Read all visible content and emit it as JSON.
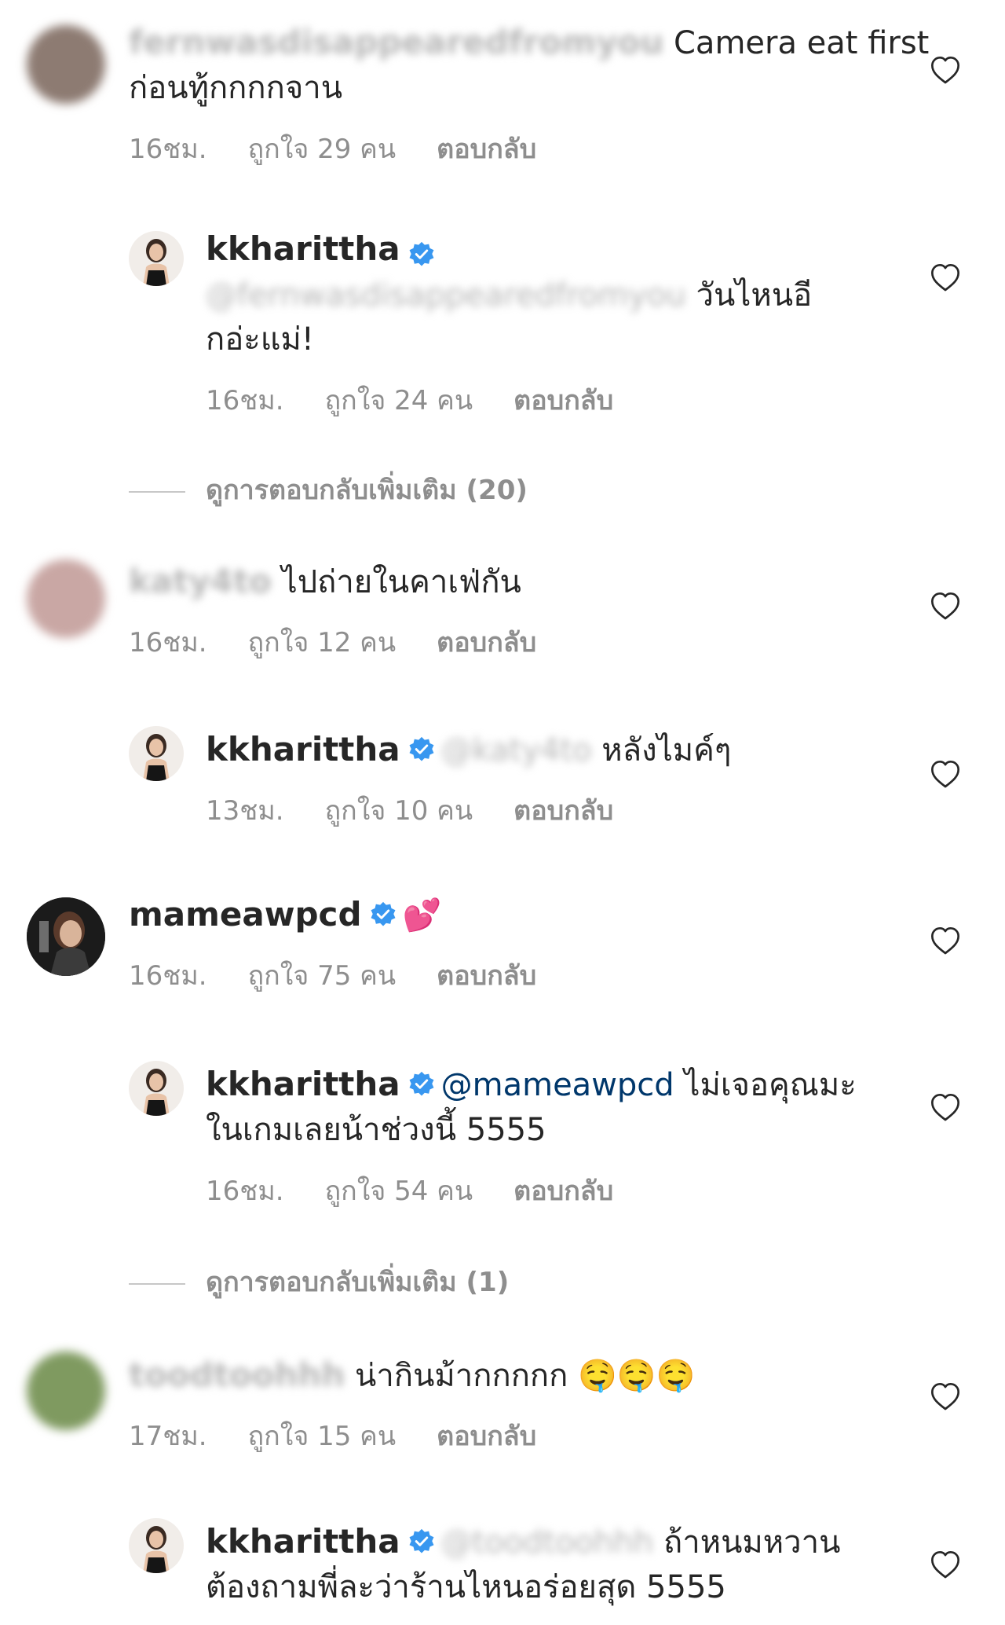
{
  "comments": [
    {
      "user": "fernwasdisappearedfromyou",
      "text1": " Camera eat first",
      "text2": "ก่อนทู้กกกกจาน",
      "time": "16ชม.",
      "likes": "ถูกใจ 29 คน",
      "reply": "ตอบกลับ"
    },
    {
      "user": "kkharittha",
      "mention": "@fernwasdisappearedfromyou",
      "text1": " วันไหนอี",
      "text2": "กอ่ะแม่!",
      "time": "16ชม.",
      "likes": "ถูกใจ 24 คน",
      "reply": "ตอบกลับ"
    },
    {
      "more": "ดูการตอบกลับเพิ่มเติม (20)"
    },
    {
      "user": "katy4to",
      "text1": " ไปถ่ายในคาเฟ่กัน",
      "time": "16ชม.",
      "likes": "ถูกใจ 12 คน",
      "reply": "ตอบกลับ"
    },
    {
      "user": "kkharittha",
      "mention": "@katy4to",
      "text1": " หลังไมค์ๆ",
      "time": "13ชม.",
      "likes": "ถูกใจ 10 คน",
      "reply": "ตอบกลับ"
    },
    {
      "user": "mameawpcd",
      "text1": "💕",
      "time": "16ชม.",
      "likes": "ถูกใจ 75 คน",
      "reply": "ตอบกลับ"
    },
    {
      "user": "kkharittha",
      "mention": "@mameawpcd",
      "text1": " ไม่เจอคุณมะ",
      "text2": "ในเกมเลยน้าช่วงนี้ 5555",
      "time": "16ชม.",
      "likes": "ถูกใจ 54 คน",
      "reply": "ตอบกลับ"
    },
    {
      "more": "ดูการตอบกลับเพิ่มเติม (1)"
    },
    {
      "user": "toodtoohhh",
      "text1": " น่ากินม้ากกกกก 🤤🤤🤤",
      "time": "17ชม.",
      "likes": "ถูกใจ 15 คน",
      "reply": "ตอบกลับ"
    },
    {
      "user": "kkharittha",
      "mention": "@toodtoohhh",
      "text1": " ถ้าหนมหวาน",
      "text2": "ต้องถามพี่ละว่าร้านไหนอร่อยสุด 5555"
    }
  ],
  "icons": {
    "like": "heart-outline-icon",
    "verified": "verified-badge-icon"
  },
  "colors": {
    "text": "#262626",
    "meta": "#8e8e8e",
    "mention": "#00376b",
    "verified": "#3897f0"
  }
}
